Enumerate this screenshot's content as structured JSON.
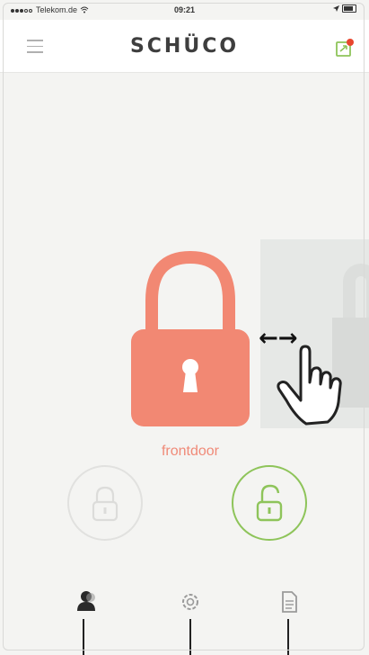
{
  "status_bar": {
    "carrier": "Telekom.de",
    "time": "09:21"
  },
  "header": {
    "logo": "SCHÜCO"
  },
  "device": {
    "name": "frontdoor",
    "state": "locked",
    "color": "#f28873"
  },
  "gesture_hint": {
    "arrows": "←→",
    "hand": "swipe-hand-icon"
  },
  "controls": {
    "lock_icon": "padlock-closed-icon",
    "unlock_icon": "padlock-open-icon",
    "unlock_color": "#8ec45a"
  },
  "tabs": [
    {
      "icon": "user-icon"
    },
    {
      "icon": "settings-gear-icon"
    },
    {
      "icon": "document-icon"
    }
  ]
}
